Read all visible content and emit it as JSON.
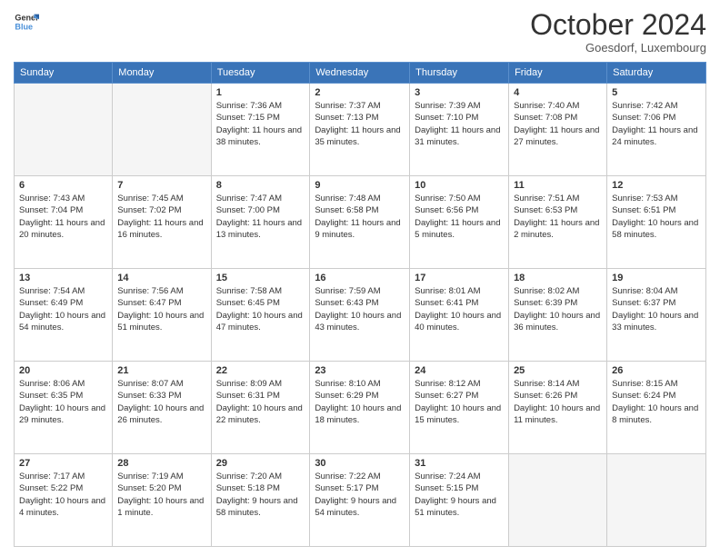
{
  "header": {
    "logo_line1": "General",
    "logo_line2": "Blue",
    "month": "October 2024",
    "location": "Goesdorf, Luxembourg"
  },
  "days_of_week": [
    "Sunday",
    "Monday",
    "Tuesday",
    "Wednesday",
    "Thursday",
    "Friday",
    "Saturday"
  ],
  "weeks": [
    [
      {
        "day": "",
        "info": ""
      },
      {
        "day": "",
        "info": ""
      },
      {
        "day": "1",
        "info": "Sunrise: 7:36 AM\nSunset: 7:15 PM\nDaylight: 11 hours and 38 minutes."
      },
      {
        "day": "2",
        "info": "Sunrise: 7:37 AM\nSunset: 7:13 PM\nDaylight: 11 hours and 35 minutes."
      },
      {
        "day": "3",
        "info": "Sunrise: 7:39 AM\nSunset: 7:10 PM\nDaylight: 11 hours and 31 minutes."
      },
      {
        "day": "4",
        "info": "Sunrise: 7:40 AM\nSunset: 7:08 PM\nDaylight: 11 hours and 27 minutes."
      },
      {
        "day": "5",
        "info": "Sunrise: 7:42 AM\nSunset: 7:06 PM\nDaylight: 11 hours and 24 minutes."
      }
    ],
    [
      {
        "day": "6",
        "info": "Sunrise: 7:43 AM\nSunset: 7:04 PM\nDaylight: 11 hours and 20 minutes."
      },
      {
        "day": "7",
        "info": "Sunrise: 7:45 AM\nSunset: 7:02 PM\nDaylight: 11 hours and 16 minutes."
      },
      {
        "day": "8",
        "info": "Sunrise: 7:47 AM\nSunset: 7:00 PM\nDaylight: 11 hours and 13 minutes."
      },
      {
        "day": "9",
        "info": "Sunrise: 7:48 AM\nSunset: 6:58 PM\nDaylight: 11 hours and 9 minutes."
      },
      {
        "day": "10",
        "info": "Sunrise: 7:50 AM\nSunset: 6:56 PM\nDaylight: 11 hours and 5 minutes."
      },
      {
        "day": "11",
        "info": "Sunrise: 7:51 AM\nSunset: 6:53 PM\nDaylight: 11 hours and 2 minutes."
      },
      {
        "day": "12",
        "info": "Sunrise: 7:53 AM\nSunset: 6:51 PM\nDaylight: 10 hours and 58 minutes."
      }
    ],
    [
      {
        "day": "13",
        "info": "Sunrise: 7:54 AM\nSunset: 6:49 PM\nDaylight: 10 hours and 54 minutes."
      },
      {
        "day": "14",
        "info": "Sunrise: 7:56 AM\nSunset: 6:47 PM\nDaylight: 10 hours and 51 minutes."
      },
      {
        "day": "15",
        "info": "Sunrise: 7:58 AM\nSunset: 6:45 PM\nDaylight: 10 hours and 47 minutes."
      },
      {
        "day": "16",
        "info": "Sunrise: 7:59 AM\nSunset: 6:43 PM\nDaylight: 10 hours and 43 minutes."
      },
      {
        "day": "17",
        "info": "Sunrise: 8:01 AM\nSunset: 6:41 PM\nDaylight: 10 hours and 40 minutes."
      },
      {
        "day": "18",
        "info": "Sunrise: 8:02 AM\nSunset: 6:39 PM\nDaylight: 10 hours and 36 minutes."
      },
      {
        "day": "19",
        "info": "Sunrise: 8:04 AM\nSunset: 6:37 PM\nDaylight: 10 hours and 33 minutes."
      }
    ],
    [
      {
        "day": "20",
        "info": "Sunrise: 8:06 AM\nSunset: 6:35 PM\nDaylight: 10 hours and 29 minutes."
      },
      {
        "day": "21",
        "info": "Sunrise: 8:07 AM\nSunset: 6:33 PM\nDaylight: 10 hours and 26 minutes."
      },
      {
        "day": "22",
        "info": "Sunrise: 8:09 AM\nSunset: 6:31 PM\nDaylight: 10 hours and 22 minutes."
      },
      {
        "day": "23",
        "info": "Sunrise: 8:10 AM\nSunset: 6:29 PM\nDaylight: 10 hours and 18 minutes."
      },
      {
        "day": "24",
        "info": "Sunrise: 8:12 AM\nSunset: 6:27 PM\nDaylight: 10 hours and 15 minutes."
      },
      {
        "day": "25",
        "info": "Sunrise: 8:14 AM\nSunset: 6:26 PM\nDaylight: 10 hours and 11 minutes."
      },
      {
        "day": "26",
        "info": "Sunrise: 8:15 AM\nSunset: 6:24 PM\nDaylight: 10 hours and 8 minutes."
      }
    ],
    [
      {
        "day": "27",
        "info": "Sunrise: 7:17 AM\nSunset: 5:22 PM\nDaylight: 10 hours and 4 minutes."
      },
      {
        "day": "28",
        "info": "Sunrise: 7:19 AM\nSunset: 5:20 PM\nDaylight: 10 hours and 1 minute."
      },
      {
        "day": "29",
        "info": "Sunrise: 7:20 AM\nSunset: 5:18 PM\nDaylight: 9 hours and 58 minutes."
      },
      {
        "day": "30",
        "info": "Sunrise: 7:22 AM\nSunset: 5:17 PM\nDaylight: 9 hours and 54 minutes."
      },
      {
        "day": "31",
        "info": "Sunrise: 7:24 AM\nSunset: 5:15 PM\nDaylight: 9 hours and 51 minutes."
      },
      {
        "day": "",
        "info": ""
      },
      {
        "day": "",
        "info": ""
      }
    ]
  ]
}
